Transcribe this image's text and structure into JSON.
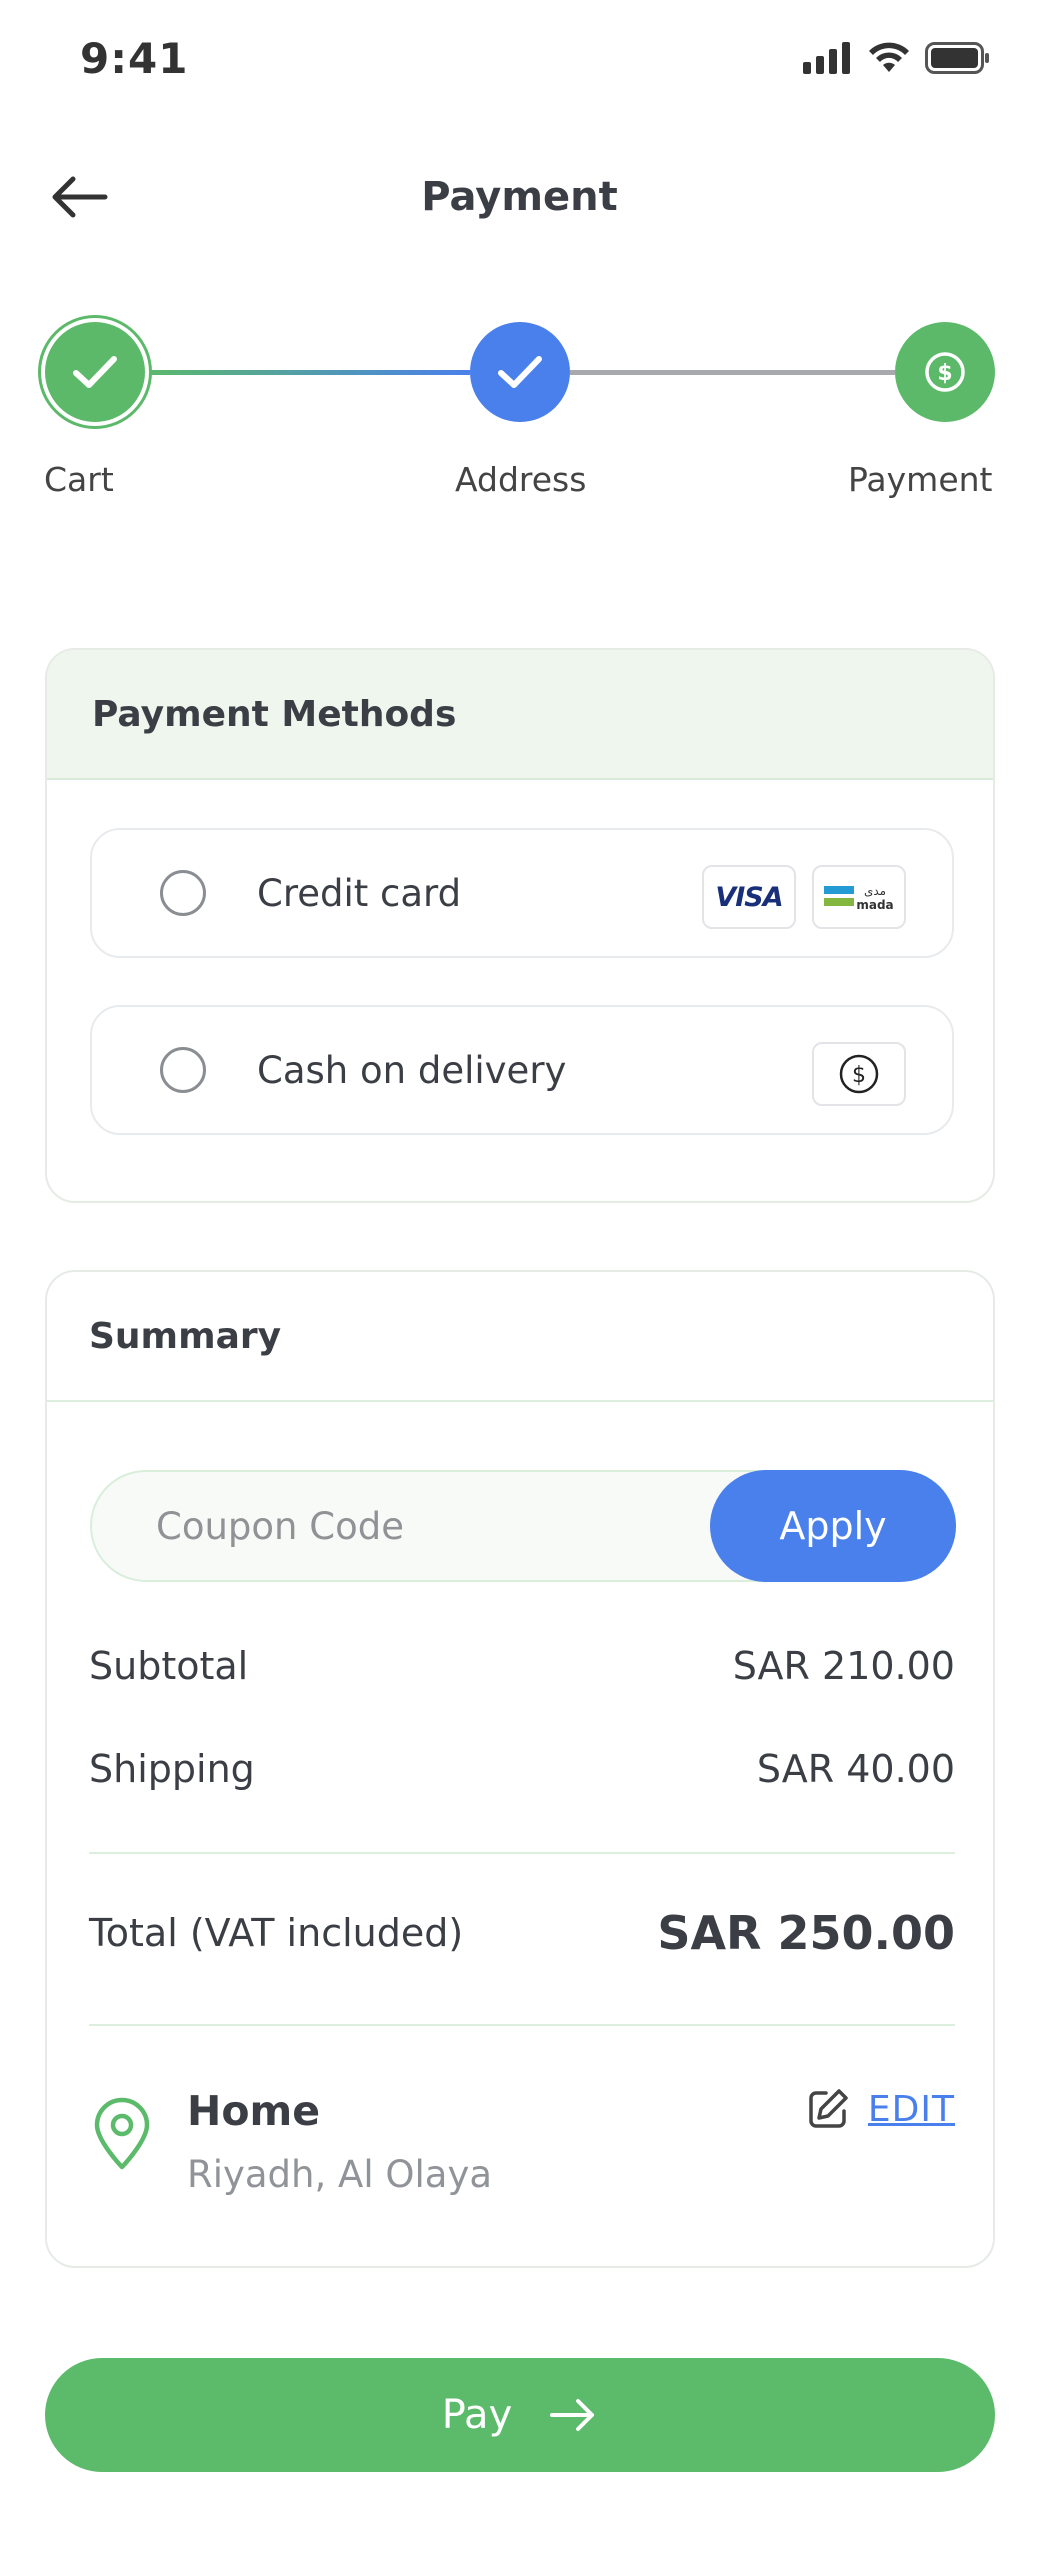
{
  "status_bar": {
    "time": "9:41"
  },
  "header": {
    "title": "Payment"
  },
  "stepper": {
    "steps": [
      {
        "label": "Cart",
        "state": "complete"
      },
      {
        "label": "Address",
        "state": "complete"
      },
      {
        "label": "Payment",
        "state": "current"
      }
    ]
  },
  "payment_methods": {
    "title": "Payment Methods",
    "options": [
      {
        "label": "Credit card",
        "selected": false,
        "badges": [
          "VISA",
          "mada"
        ]
      },
      {
        "label": "Cash on delivery",
        "selected": false,
        "badges": [
          "cash-icon"
        ]
      }
    ],
    "visa_text": "VISA",
    "mada_arabic": "مدى",
    "mada_latin": "mada"
  },
  "summary": {
    "title": "Summary",
    "coupon": {
      "placeholder": "Coupon Code",
      "value": "",
      "apply_label": "Apply"
    },
    "subtotal_label": "Subtotal",
    "subtotal_value": "SAR 210.00",
    "shipping_label": "Shipping",
    "shipping_value": "SAR 40.00",
    "total_label": "Total (VAT included)",
    "total_value": "SAR 250.00",
    "address": {
      "name": "Home",
      "detail": "Riyadh, Al Olaya",
      "edit_label": "EDIT"
    }
  },
  "pay_button": {
    "label": "Pay"
  },
  "colors": {
    "green": "#5cba6b",
    "blue": "#4a80ec",
    "text": "#3b3f45",
    "muted": "#909499"
  }
}
